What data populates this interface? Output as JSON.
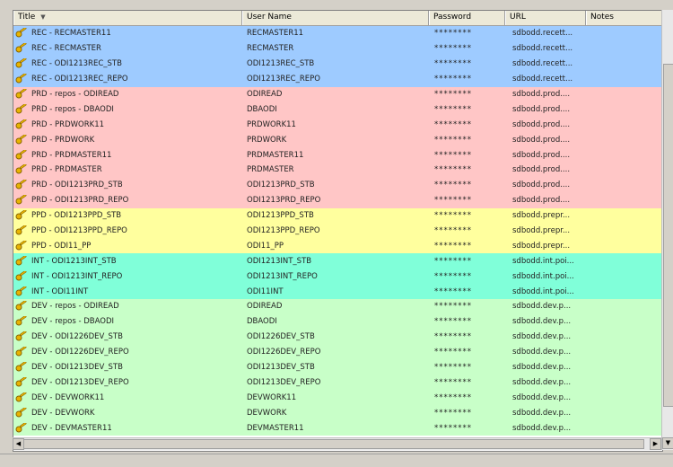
{
  "columns": [
    {
      "label": "Title",
      "width": 255
    },
    {
      "label": "User Name",
      "width": 208
    },
    {
      "label": "Password",
      "width": 85
    },
    {
      "label": "URL",
      "width": 90
    },
    {
      "label": "Notes",
      "width": 85
    }
  ],
  "colors": {
    "rec": "#9ecbff",
    "prd": "#ffc6c6",
    "ppd": "#ffff9e",
    "int": "#80ffd9",
    "dev": "#c8ffc8"
  },
  "rows": [
    {
      "group": "rec",
      "title": "REC - RECMASTER11",
      "user": "RECMASTER11",
      "password": "********",
      "url": "sdbodd.recett..."
    },
    {
      "group": "rec",
      "title": "REC - RECMASTER",
      "user": "RECMASTER",
      "password": "********",
      "url": "sdbodd.recett..."
    },
    {
      "group": "rec",
      "title": "REC - ODI1213REC_STB",
      "user": "ODI1213REC_STB",
      "password": "********",
      "url": "sdbodd.recett..."
    },
    {
      "group": "rec",
      "title": "REC - ODI1213REC_REPO",
      "user": "ODI1213REC_REPO",
      "password": "********",
      "url": "sdbodd.recett..."
    },
    {
      "group": "prd",
      "title": "PRD - repos - ODIREAD",
      "user": "ODIREAD",
      "password": "********",
      "url": "sdbodd.prod...."
    },
    {
      "group": "prd",
      "title": "PRD - repos - DBAODI",
      "user": "DBAODI",
      "password": "********",
      "url": "sdbodd.prod...."
    },
    {
      "group": "prd",
      "title": "PRD - PRDWORK11",
      "user": "PRDWORK11",
      "password": "********",
      "url": "sdbodd.prod...."
    },
    {
      "group": "prd",
      "title": "PRD - PRDWORK",
      "user": "PRDWORK",
      "password": "********",
      "url": "sdbodd.prod...."
    },
    {
      "group": "prd",
      "title": "PRD - PRDMASTER11",
      "user": "PRDMASTER11",
      "password": "********",
      "url": "sdbodd.prod...."
    },
    {
      "group": "prd",
      "title": "PRD - PRDMASTER",
      "user": "PRDMASTER",
      "password": "********",
      "url": "sdbodd.prod...."
    },
    {
      "group": "prd",
      "title": "PRD - ODI1213PRD_STB",
      "user": "ODI1213PRD_STB",
      "password": "********",
      "url": "sdbodd.prod...."
    },
    {
      "group": "prd",
      "title": "PRD - ODI1213PRD_REPO",
      "user": "ODI1213PRD_REPO",
      "password": "********",
      "url": "sdbodd.prod...."
    },
    {
      "group": "ppd",
      "title": "PPD - ODI1213PPD_STB",
      "user": "ODI1213PPD_STB",
      "password": "********",
      "url": "sdbodd.prepr..."
    },
    {
      "group": "ppd",
      "title": "PPD - ODI1213PPD_REPO",
      "user": "ODI1213PPD_REPO",
      "password": "********",
      "url": "sdbodd.prepr..."
    },
    {
      "group": "ppd",
      "title": "PPD - ODI11_PP",
      "user": "ODI11_PP",
      "password": "********",
      "url": "sdbodd.prepr..."
    },
    {
      "group": "int",
      "title": "INT - ODI1213INT_STB",
      "user": "ODI1213INT_STB",
      "password": "********",
      "url": "sdbodd.int.poi..."
    },
    {
      "group": "int",
      "title": "INT - ODI1213INT_REPO",
      "user": "ODI1213INT_REPO",
      "password": "********",
      "url": "sdbodd.int.poi..."
    },
    {
      "group": "int",
      "title": "INT - ODI11INT",
      "user": "ODI11INT",
      "password": "********",
      "url": "sdbodd.int.poi..."
    },
    {
      "group": "dev",
      "title": "DEV - repos - ODIREAD",
      "user": "ODIREAD",
      "password": "********",
      "url": "sdbodd.dev.p..."
    },
    {
      "group": "dev",
      "title": "DEV - repos - DBAODI",
      "user": "DBAODI",
      "password": "********",
      "url": "sdbodd.dev.p..."
    },
    {
      "group": "dev",
      "title": "DEV - ODI1226DEV_STB",
      "user": "ODI1226DEV_STB",
      "password": "********",
      "url": "sdbodd.dev.p..."
    },
    {
      "group": "dev",
      "title": "DEV - ODI1226DEV_REPO",
      "user": "ODI1226DEV_REPO",
      "password": "********",
      "url": "sdbodd.dev.p..."
    },
    {
      "group": "dev",
      "title": "DEV - ODI1213DEV_STB",
      "user": "ODI1213DEV_STB",
      "password": "********",
      "url": "sdbodd.dev.p..."
    },
    {
      "group": "dev",
      "title": "DEV - ODI1213DEV_REPO",
      "user": "ODI1213DEV_REPO",
      "password": "********",
      "url": "sdbodd.dev.p..."
    },
    {
      "group": "dev",
      "title": "DEV - DEVWORK11",
      "user": "DEVWORK11",
      "password": "********",
      "url": "sdbodd.dev.p..."
    },
    {
      "group": "dev",
      "title": "DEV - DEVWORK",
      "user": "DEVWORK",
      "password": "********",
      "url": "sdbodd.dev.p..."
    },
    {
      "group": "dev",
      "title": "DEV - DEVMASTER11",
      "user": "DEVMASTER11",
      "password": "********",
      "url": "sdbodd.dev.p..."
    }
  ],
  "icons": {
    "entry": "key-icon",
    "sort": "sort-down-icon"
  }
}
